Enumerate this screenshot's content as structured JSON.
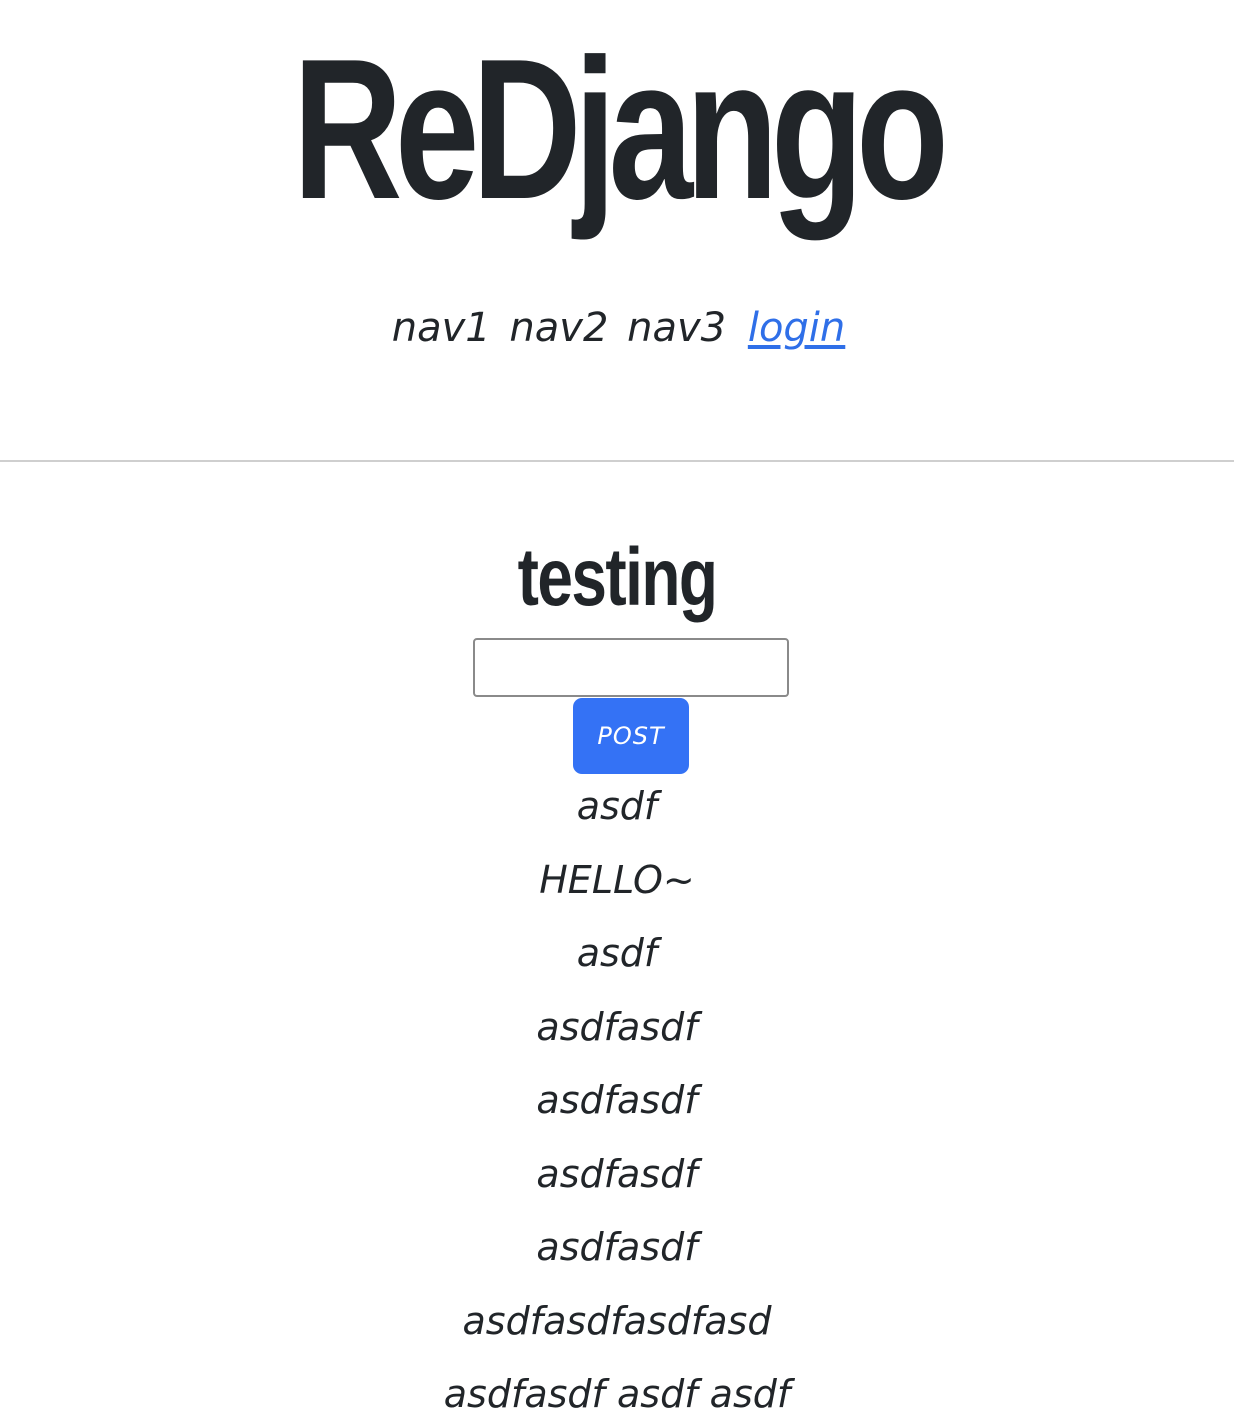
{
  "header": {
    "site_title": "ReDjango",
    "nav": {
      "items": [
        "nav1",
        "nav2",
        "nav3"
      ],
      "login_label": "login"
    }
  },
  "main": {
    "heading": "testing",
    "post_input": {
      "value": "",
      "placeholder": ""
    },
    "post_button_label": "POST",
    "posts": [
      "asdf",
      "HELLO~",
      "asdf",
      "asdfasdf",
      "asdfasdf",
      "asdfasdf",
      "asdfasdf",
      "asdfasdfasdfasd",
      "asdfasdf asdf asdf"
    ]
  },
  "colors": {
    "text": "#212529",
    "link": "#2f6fe8",
    "button": "#3472f5",
    "divider": "#cfcfcf"
  }
}
